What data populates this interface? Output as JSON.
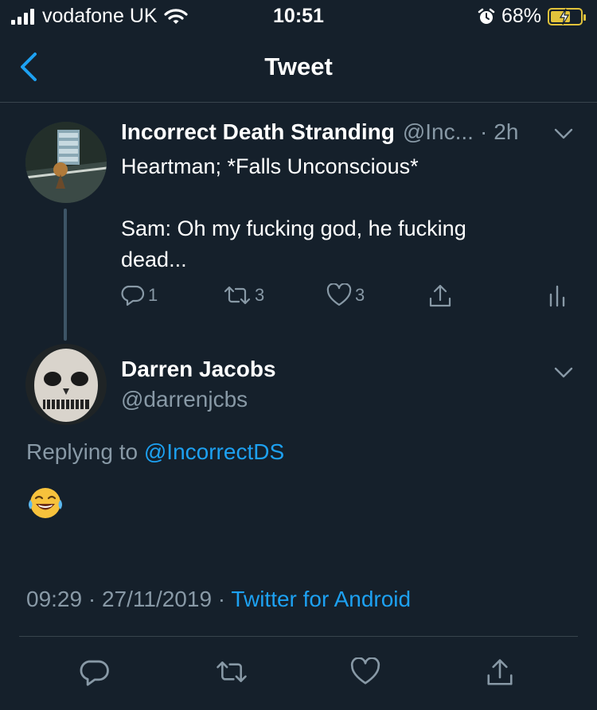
{
  "status_bar": {
    "carrier": "vodafone UK",
    "time": "10:51",
    "battery_percent": "68%",
    "battery_level": 0.68,
    "charging": true
  },
  "nav": {
    "title": "Tweet"
  },
  "parent_tweet": {
    "name": "Incorrect Death Stranding",
    "handle": "@Inc...",
    "separator": "·",
    "age": "2h",
    "lines": [
      "Heartman; *Falls Unconscious*",
      "",
      "Sam: Oh my fucking god, he fucking",
      "dead..."
    ],
    "reply_count": "1",
    "retweet_count": "3",
    "like_count": "3"
  },
  "reply_tweet": {
    "name": "Darren Jacobs",
    "handle": "@darrenjcbs",
    "replying_prefix": "Replying to",
    "replying_to": "@IncorrectDS",
    "body_emoji": "😂",
    "time": "09:29",
    "sep1": " · ",
    "date": "27/11/2019",
    "sep2": " · ",
    "source": "Twitter for Android"
  },
  "colors": {
    "background": "#15202b",
    "accent": "#1da1f2",
    "muted": "#8899a6",
    "divider": "#38444d",
    "battery": "#e2c33b"
  },
  "icons": [
    "signal-icon",
    "wifi-icon",
    "alarm-icon",
    "battery-icon",
    "back-chevron-icon",
    "chevron-down-icon",
    "reply-icon",
    "retweet-icon",
    "like-icon",
    "share-icon",
    "analytics-icon",
    "laughing-emoji"
  ]
}
